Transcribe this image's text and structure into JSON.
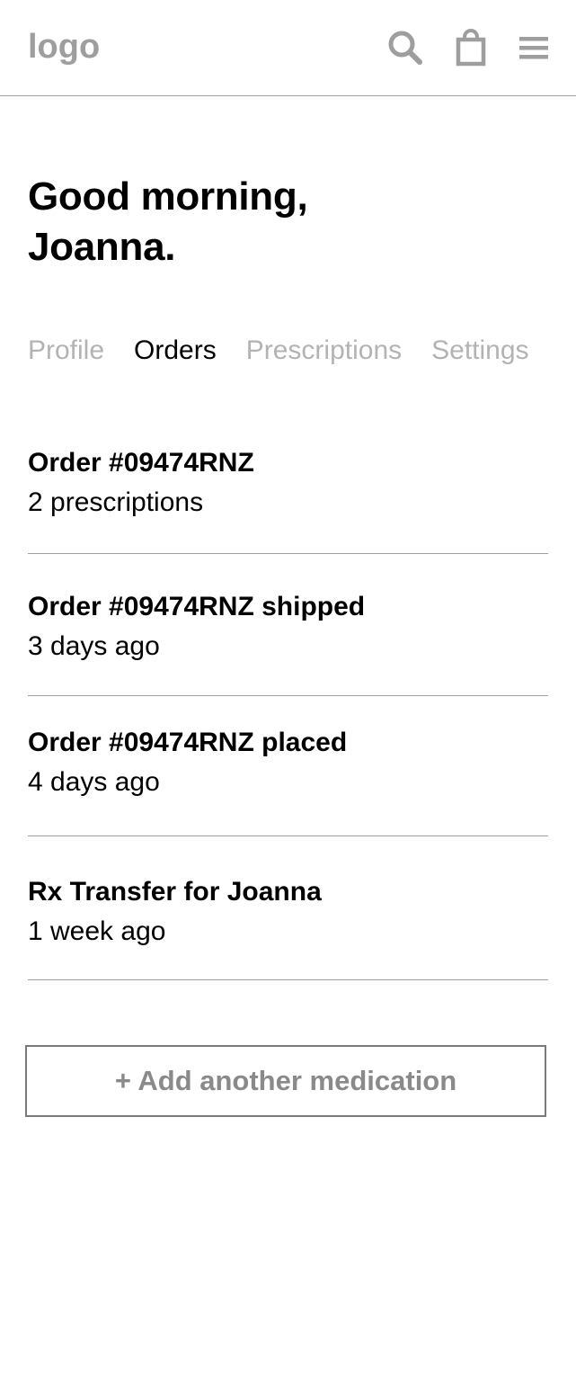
{
  "header": {
    "logo_text": "logo",
    "icons": [
      "search-icon",
      "shopping-bag-icon",
      "hamburger-menu-icon"
    ],
    "icon_color": "#9e9e9e"
  },
  "greeting": {
    "line1": "Good morning,",
    "line2": "Joanna."
  },
  "tabs": [
    {
      "label": "Profile",
      "active": false
    },
    {
      "label": "Orders",
      "active": true
    },
    {
      "label": "Prescriptions",
      "active": false
    },
    {
      "label": "Settings",
      "active": false
    }
  ],
  "orders": [
    {
      "title": "Order #09474RNZ",
      "subtitle": "2 prescriptions"
    },
    {
      "title": "Order #09474RNZ shipped",
      "subtitle": "3 days ago"
    },
    {
      "title": "Order #09474RNZ placed",
      "subtitle": "4 days ago"
    },
    {
      "title": "Rx Transfer for Joanna",
      "subtitle": "1 week ago"
    }
  ],
  "add_button": {
    "label": "+ Add another medication"
  },
  "colors": {
    "text": "#000000",
    "muted": "#b3b3b3",
    "divider": "#9e9e9e",
    "button_text": "#8a8a8a"
  }
}
